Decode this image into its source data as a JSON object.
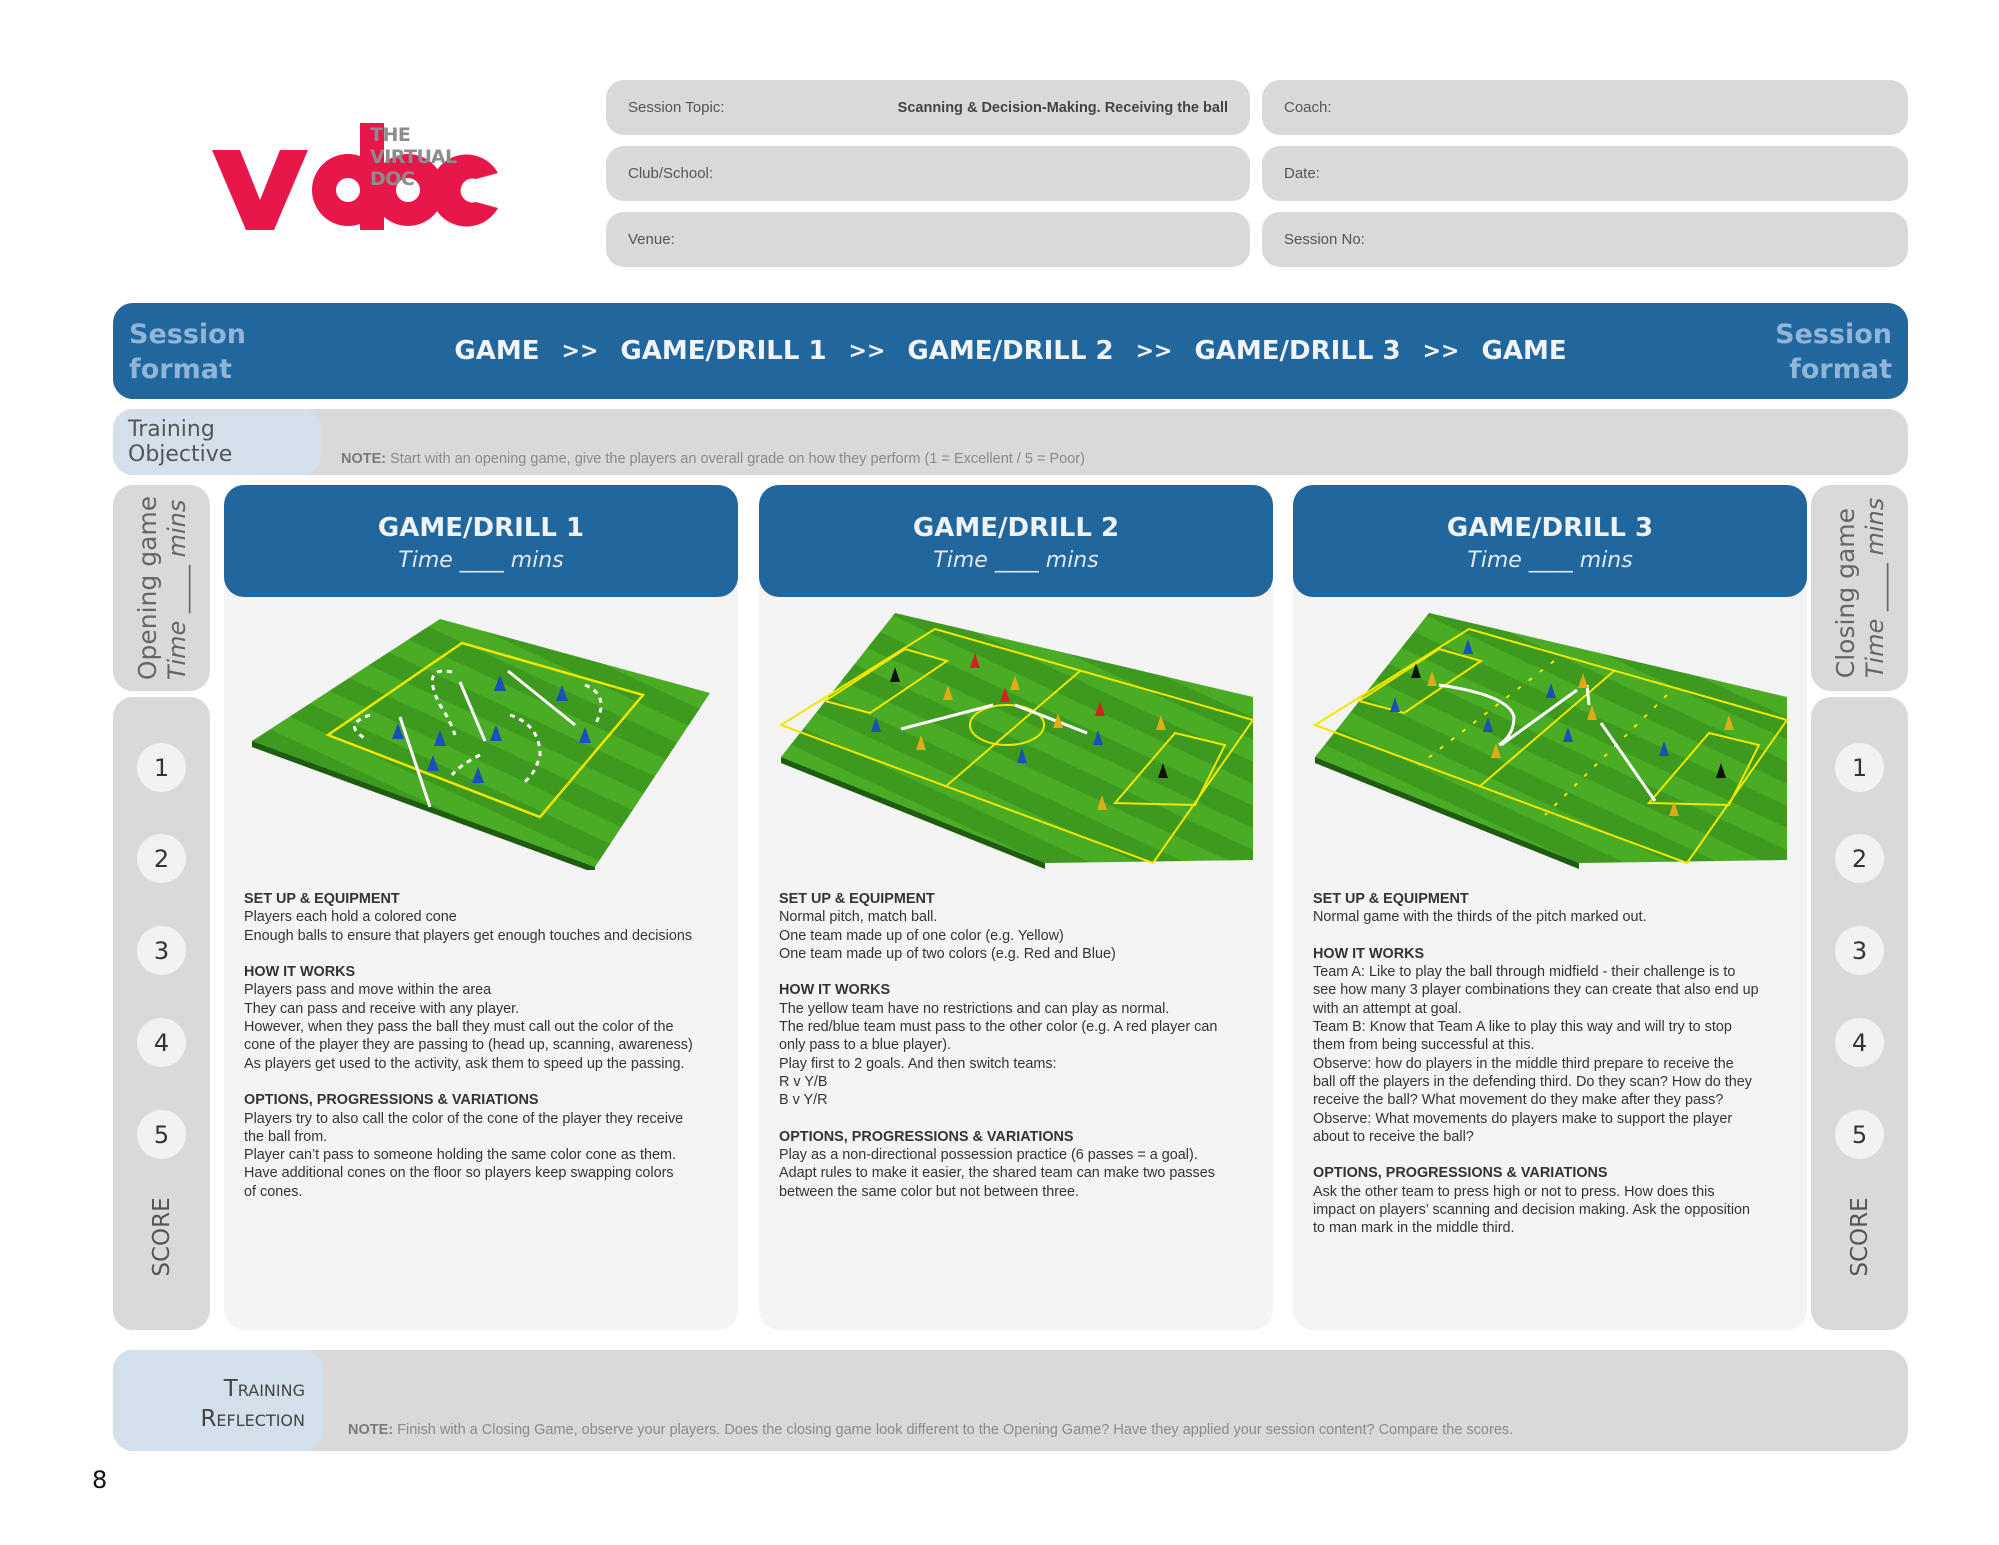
{
  "logo": {
    "wordmark": "vdoc",
    "tagline": "THE VIRTUAL DOC",
    "brand_color": "#e8174a"
  },
  "fields": {
    "session_topic": {
      "label": "Session Topic:",
      "value": "Scanning & Decision-Making. Receiving the ball"
    },
    "club_school": {
      "label": "Club/School:",
      "value": ""
    },
    "venue": {
      "label": "Venue:",
      "value": ""
    },
    "coach": {
      "label": "Coach:",
      "value": ""
    },
    "date": {
      "label": "Date:",
      "value": ""
    },
    "session_no": {
      "label": "Session No:",
      "value": ""
    }
  },
  "session_format": {
    "left_label_line1": "Session",
    "left_label_line2": "format",
    "right_label_line1": "Session",
    "right_label_line2": "format",
    "steps": [
      "GAME",
      "GAME/DRILL 1",
      "GAME/DRILL 2",
      "GAME/DRILL 3",
      "GAME"
    ],
    "separator": ">>",
    "accent_color": "#21679e"
  },
  "training_objective": {
    "label": "Training Objective",
    "note_prefix": "NOTE:",
    "note_text": " Start with an opening game, give the players an overall grade on how they perform (1 = Excellent / 5 = Poor)"
  },
  "opening_game": {
    "title": "Opening game",
    "time": "Time ____ mins"
  },
  "closing_game": {
    "title": "Closing game",
    "time": "Time ____ mins"
  },
  "score": {
    "label": "SCORE",
    "values": [
      "1",
      "2",
      "3",
      "4",
      "5"
    ]
  },
  "drills": [
    {
      "title": "GAME/DRILL 1",
      "time": "Time ____ mins",
      "diagram": "passing-area-diagram",
      "sections": [
        {
          "title": "SET UP & EQUIPMENT",
          "lines": [
            "Players each hold a colored cone",
            "Enough balls to ensure that players get enough touches and decisions"
          ]
        },
        {
          "title": "HOW IT WORKS",
          "lines": [
            "Players pass and move within the area",
            "They can pass and receive with any player.",
            "However, when they pass the ball they must call out the color of the",
            "cone of the player they are passing to (head up, scanning, awareness)",
            "As players get used to the activity, ask them to speed up the passing."
          ]
        },
        {
          "title": "OPTIONS, PROGRESSIONS & VARIATIONS",
          "lines": [
            "Players try to also call the color of the cone of the player they receive",
            "the ball from.",
            "Player can’t pass to someone holding the same color cone as them.",
            "Have additional cones on the floor so players keep swapping colors",
            "of cones."
          ]
        }
      ]
    },
    {
      "title": "GAME/DRILL 2",
      "time": "Time ____ mins",
      "diagram": "full-pitch-diagram",
      "sections": [
        {
          "title": "SET UP & EQUIPMENT",
          "lines": [
            "Normal pitch, match ball.",
            "One team made up of one color (e.g. Yellow)",
            "One team made up of two colors (e.g. Red and Blue)"
          ]
        },
        {
          "title": "HOW IT WORKS",
          "lines": [
            "The yellow team have no restrictions and can play as normal.",
            "The red/blue team must pass to the other color (e.g. A red player can",
            "only pass to a blue player).",
            "Play first to 2 goals. And then switch teams:",
            "R v Y/B",
            "B v Y/R"
          ]
        },
        {
          "title": "OPTIONS, PROGRESSIONS & VARIATIONS",
          "lines": [
            "Play as a non-directional possession practice (6 passes = a goal).",
            "Adapt rules to make it easier, the shared team can make two passes",
            "between the same color but not between three."
          ]
        }
      ]
    },
    {
      "title": "GAME/DRILL 3",
      "time": "Time ____ mins",
      "diagram": "thirds-pitch-diagram",
      "sections": [
        {
          "title": "SET UP & EQUIPMENT",
          "lines": [
            "Normal game with the thirds of the pitch marked out."
          ]
        },
        {
          "title": "HOW IT WORKS",
          "lines": [
            "Team A: Like to play the ball through midfield - their challenge is to",
            "see how many 3 player combinations they can create that also end up",
            "with an attempt at goal.",
            "Team B: Know that Team A like to play this way and will try to stop",
            "them from being successful at this.",
            "Observe: how do players in the middle third prepare to receive the",
            "ball off the players in the defending third. Do they scan? How do they",
            "receive the ball? What movement do they make after they pass?",
            "Observe: What movements do players make to support the player",
            "about to receive the ball?"
          ]
        },
        {
          "title": "OPTIONS, PROGRESSIONS & VARIATIONS",
          "lines": [
            "Ask the other team to press high or not to press. How does this",
            "impact on players’ scanning and decision making. Ask the opposition",
            "to man mark in the middle third."
          ]
        }
      ]
    }
  ],
  "training_reflection": {
    "label_line1": "Training",
    "label_line2": "Reflection",
    "note_prefix": "NOTE:",
    "note_text": " Finish with a Closing Game, observe your players.  Does the closing game look different to the Opening Game? Have they applied your session content? Compare the scores."
  },
  "page_number": "8"
}
